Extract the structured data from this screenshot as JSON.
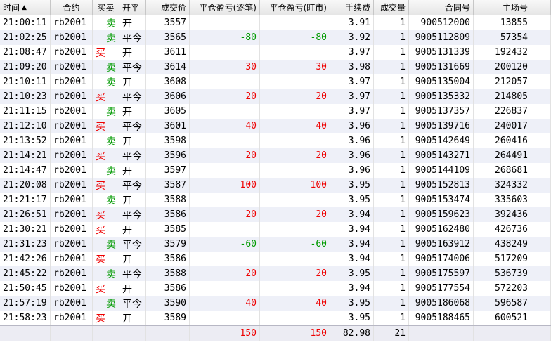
{
  "columns": {
    "time": "时间",
    "contract": "合约",
    "side": "买卖",
    "openclose": "开平",
    "price": "成交价",
    "pnl_close": "平仓盈亏(逐笔)",
    "pnl_mark": "平仓盈亏(盯市)",
    "fee": "手续费",
    "qty": "成交量",
    "contract_no": "合同号",
    "exch_no": "主场号"
  },
  "sort_indicator": "▲",
  "rows": [
    {
      "time": "21:00:11",
      "contract": "rb2001",
      "side": "卖",
      "openclose": "开",
      "price": "3557",
      "pnl_close": "",
      "pnl_mark": "",
      "fee": "3.91",
      "qty": "1",
      "contract_no": "900512000",
      "exch_no": "13855"
    },
    {
      "time": "21:02:25",
      "contract": "rb2001",
      "side": "卖",
      "openclose": "平今",
      "price": "3565",
      "pnl_close": "-80",
      "pnl_mark": "-80",
      "fee": "3.92",
      "qty": "1",
      "contract_no": "9005112809",
      "exch_no": "57354"
    },
    {
      "time": "21:08:47",
      "contract": "rb2001",
      "side": "买",
      "openclose": "开",
      "price": "3611",
      "pnl_close": "",
      "pnl_mark": "",
      "fee": "3.97",
      "qty": "1",
      "contract_no": "9005131339",
      "exch_no": "192432"
    },
    {
      "time": "21:09:20",
      "contract": "rb2001",
      "side": "卖",
      "openclose": "平今",
      "price": "3614",
      "pnl_close": "30",
      "pnl_mark": "30",
      "fee": "3.98",
      "qty": "1",
      "contract_no": "9005131669",
      "exch_no": "200120"
    },
    {
      "time": "21:10:11",
      "contract": "rb2001",
      "side": "卖",
      "openclose": "开",
      "price": "3608",
      "pnl_close": "",
      "pnl_mark": "",
      "fee": "3.97",
      "qty": "1",
      "contract_no": "9005135004",
      "exch_no": "212057"
    },
    {
      "time": "21:10:23",
      "contract": "rb2001",
      "side": "买",
      "openclose": "平今",
      "price": "3606",
      "pnl_close": "20",
      "pnl_mark": "20",
      "fee": "3.97",
      "qty": "1",
      "contract_no": "9005135332",
      "exch_no": "214805"
    },
    {
      "time": "21:11:15",
      "contract": "rb2001",
      "side": "卖",
      "openclose": "开",
      "price": "3605",
      "pnl_close": "",
      "pnl_mark": "",
      "fee": "3.97",
      "qty": "1",
      "contract_no": "9005137357",
      "exch_no": "226837"
    },
    {
      "time": "21:12:10",
      "contract": "rb2001",
      "side": "买",
      "openclose": "平今",
      "price": "3601",
      "pnl_close": "40",
      "pnl_mark": "40",
      "fee": "3.96",
      "qty": "1",
      "contract_no": "9005139716",
      "exch_no": "240017"
    },
    {
      "time": "21:13:52",
      "contract": "rb2001",
      "side": "卖",
      "openclose": "开",
      "price": "3598",
      "pnl_close": "",
      "pnl_mark": "",
      "fee": "3.96",
      "qty": "1",
      "contract_no": "9005142649",
      "exch_no": "260416"
    },
    {
      "time": "21:14:21",
      "contract": "rb2001",
      "side": "买",
      "openclose": "平今",
      "price": "3596",
      "pnl_close": "20",
      "pnl_mark": "20",
      "fee": "3.96",
      "qty": "1",
      "contract_no": "9005143271",
      "exch_no": "264491"
    },
    {
      "time": "21:14:47",
      "contract": "rb2001",
      "side": "卖",
      "openclose": "开",
      "price": "3597",
      "pnl_close": "",
      "pnl_mark": "",
      "fee": "3.96",
      "qty": "1",
      "contract_no": "9005144109",
      "exch_no": "268681"
    },
    {
      "time": "21:20:08",
      "contract": "rb2001",
      "side": "买",
      "openclose": "平今",
      "price": "3587",
      "pnl_close": "100",
      "pnl_mark": "100",
      "fee": "3.95",
      "qty": "1",
      "contract_no": "9005152813",
      "exch_no": "324332"
    },
    {
      "time": "21:21:17",
      "contract": "rb2001",
      "side": "卖",
      "openclose": "开",
      "price": "3588",
      "pnl_close": "",
      "pnl_mark": "",
      "fee": "3.95",
      "qty": "1",
      "contract_no": "9005153474",
      "exch_no": "335603"
    },
    {
      "time": "21:26:51",
      "contract": "rb2001",
      "side": "买",
      "openclose": "平今",
      "price": "3586",
      "pnl_close": "20",
      "pnl_mark": "20",
      "fee": "3.94",
      "qty": "1",
      "contract_no": "9005159623",
      "exch_no": "392436"
    },
    {
      "time": "21:30:21",
      "contract": "rb2001",
      "side": "买",
      "openclose": "开",
      "price": "3585",
      "pnl_close": "",
      "pnl_mark": "",
      "fee": "3.94",
      "qty": "1",
      "contract_no": "9005162480",
      "exch_no": "426736"
    },
    {
      "time": "21:31:23",
      "contract": "rb2001",
      "side": "卖",
      "openclose": "平今",
      "price": "3579",
      "pnl_close": "-60",
      "pnl_mark": "-60",
      "fee": "3.94",
      "qty": "1",
      "contract_no": "9005163912",
      "exch_no": "438249"
    },
    {
      "time": "21:42:26",
      "contract": "rb2001",
      "side": "买",
      "openclose": "开",
      "price": "3586",
      "pnl_close": "",
      "pnl_mark": "",
      "fee": "3.94",
      "qty": "1",
      "contract_no": "9005174006",
      "exch_no": "517209"
    },
    {
      "time": "21:45:22",
      "contract": "rb2001",
      "side": "卖",
      "openclose": "平今",
      "price": "3588",
      "pnl_close": "20",
      "pnl_mark": "20",
      "fee": "3.95",
      "qty": "1",
      "contract_no": "9005175597",
      "exch_no": "536739"
    },
    {
      "time": "21:50:45",
      "contract": "rb2001",
      "side": "买",
      "openclose": "开",
      "price": "3586",
      "pnl_close": "",
      "pnl_mark": "",
      "fee": "3.94",
      "qty": "1",
      "contract_no": "9005177554",
      "exch_no": "572203"
    },
    {
      "time": "21:57:19",
      "contract": "rb2001",
      "side": "卖",
      "openclose": "平今",
      "price": "3590",
      "pnl_close": "40",
      "pnl_mark": "40",
      "fee": "3.95",
      "qty": "1",
      "contract_no": "9005186068",
      "exch_no": "596587"
    },
    {
      "time": "21:58:23",
      "contract": "rb2001",
      "side": "买",
      "openclose": "开",
      "price": "3589",
      "pnl_close": "",
      "pnl_mark": "",
      "fee": "3.95",
      "qty": "1",
      "contract_no": "9005188465",
      "exch_no": "600521"
    }
  ],
  "totals": {
    "pnl_close": "150",
    "pnl_mark": "150",
    "fee": "82.98",
    "qty": "21"
  },
  "colors": {
    "profit": "#ee0000",
    "loss": "#009a00",
    "buy": "#ee0000",
    "sell": "#009a00",
    "row_alt": "#eef0f8"
  }
}
